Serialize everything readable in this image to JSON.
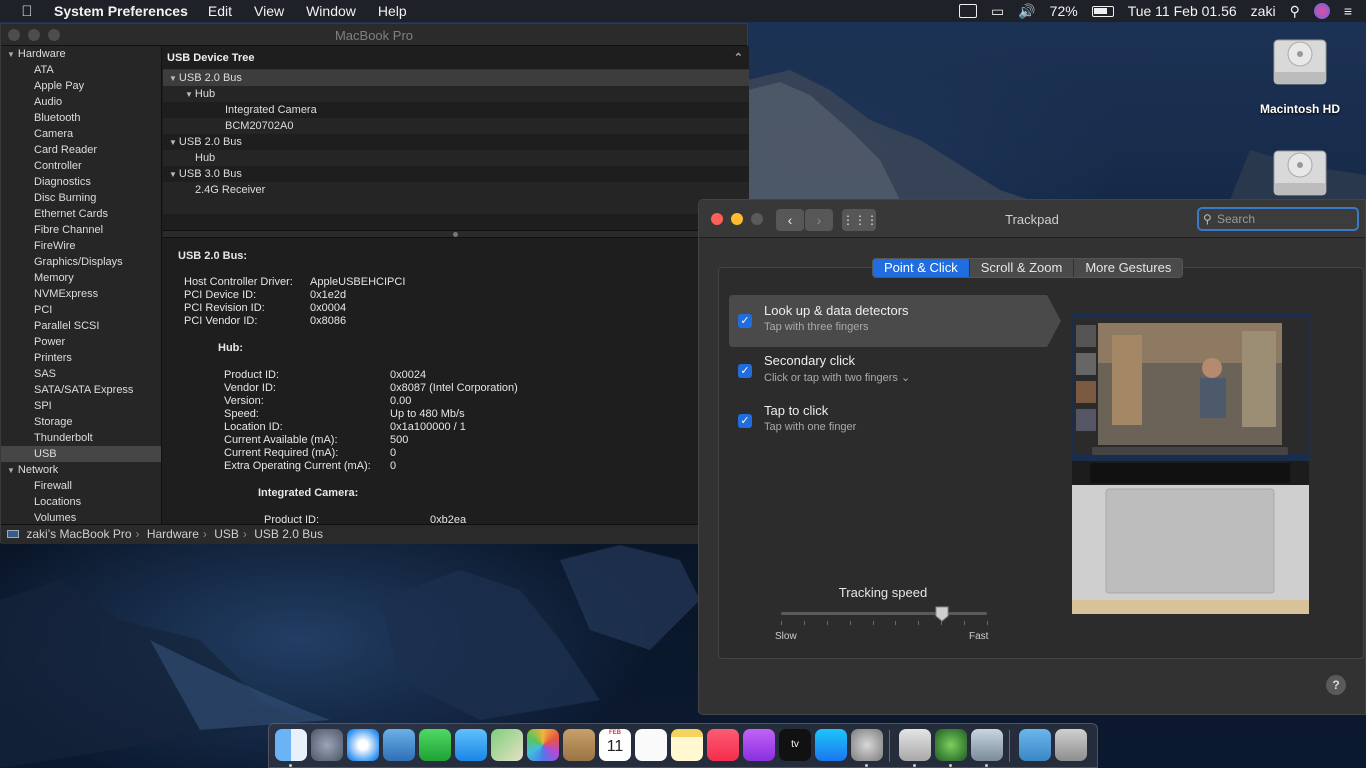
{
  "menubar": {
    "app_name": "System Preferences",
    "menus": [
      "Edit",
      "View",
      "Window",
      "Help"
    ],
    "battery": "72%",
    "clock": "Tue 11 Feb  01.56",
    "user": "zaki"
  },
  "system_info": {
    "title": "MacBook Pro",
    "sidebar": {
      "hardware_label": "Hardware",
      "hardware_items": [
        "ATA",
        "Apple Pay",
        "Audio",
        "Bluetooth",
        "Camera",
        "Card Reader",
        "Controller",
        "Diagnostics",
        "Disc Burning",
        "Ethernet Cards",
        "Fibre Channel",
        "FireWire",
        "Graphics/Displays",
        "Memory",
        "NVMExpress",
        "PCI",
        "Parallel SCSI",
        "Power",
        "Printers",
        "SAS",
        "SATA/SATA Express",
        "SPI",
        "Storage",
        "Thunderbolt",
        "USB"
      ],
      "selected": "USB",
      "network_label": "Network",
      "network_items": [
        "Firewall",
        "Locations",
        "Volumes"
      ]
    },
    "tree": {
      "header": "USB Device Tree",
      "rows": [
        {
          "label": "USB 2.0 Bus",
          "level": 0,
          "expanded": true
        },
        {
          "label": "Hub",
          "level": 1,
          "expanded": true
        },
        {
          "label": "Integrated Camera",
          "level": 2,
          "expanded": false
        },
        {
          "label": "BCM20702A0",
          "level": 2,
          "expanded": false
        },
        {
          "label": "USB 2.0 Bus",
          "level": 0,
          "expanded": true
        },
        {
          "label": "Hub",
          "level": 1,
          "expanded": false
        },
        {
          "label": "USB 3.0 Bus",
          "level": 0,
          "expanded": true
        },
        {
          "label": "2.4G Receiver",
          "level": 1,
          "expanded": false
        }
      ]
    },
    "detail": {
      "bus_title": "USB 2.0 Bus:",
      "bus_props": [
        {
          "k": "Host Controller Driver:",
          "v": "AppleUSBEHCIPCI"
        },
        {
          "k": "PCI Device ID:",
          "v": "0x1e2d"
        },
        {
          "k": "PCI Revision ID:",
          "v": "0x0004"
        },
        {
          "k": "PCI Vendor ID:",
          "v": "0x8086"
        }
      ],
      "hub_title": "Hub:",
      "hub_props": [
        {
          "k": "Product ID:",
          "v": "0x0024"
        },
        {
          "k": "Vendor ID:",
          "v": "0x8087  (Intel Corporation)"
        },
        {
          "k": "Version:",
          "v": "0.00"
        },
        {
          "k": "Speed:",
          "v": "Up to 480 Mb/s"
        },
        {
          "k": "Location ID:",
          "v": "0x1a100000 / 1"
        },
        {
          "k": "Current Available (mA):",
          "v": "500"
        },
        {
          "k": "Current Required (mA):",
          "v": "0"
        },
        {
          "k": "Extra Operating Current (mA):",
          "v": "0"
        }
      ],
      "camera_title": "Integrated Camera:",
      "camera_props": [
        {
          "k": "Product ID:",
          "v": "0xb2ea"
        }
      ]
    },
    "path": [
      "zaki’s MacBook Pro",
      "Hardware",
      "USB",
      "USB 2.0 Bus"
    ]
  },
  "trackpad": {
    "title": "Trackpad",
    "search_placeholder": "Search",
    "tabs": [
      "Point & Click",
      "Scroll & Zoom",
      "More Gestures"
    ],
    "active_tab": "Point & Click",
    "options": [
      {
        "title": "Look up & data detectors",
        "subtitle": "Tap with three fingers",
        "checked": true,
        "selected": true
      },
      {
        "title": "Secondary click",
        "subtitle": "Click or tap with two fingers",
        "checked": true,
        "selected": false
      },
      {
        "title": "Tap to click",
        "subtitle": "Tap with one finger",
        "checked": true,
        "selected": false
      }
    ],
    "tracking_speed_label": "Tracking speed",
    "slow_label": "Slow",
    "fast_label": "Fast",
    "tracking_speed_value": 0.78,
    "help": "?"
  },
  "desktop": {
    "disk_label": "Macintosh HD"
  },
  "dock": {
    "apps": [
      "finder-icon",
      "launchpad-icon",
      "safari-icon",
      "mail-icon",
      "facetime-icon",
      "messages-icon",
      "maps-icon",
      "photos-icon",
      "contacts-icon",
      "calendar-icon",
      "reminders-icon",
      "notes-icon",
      "music-icon",
      "podcasts-icon",
      "tv-icon",
      "app-store-icon",
      "system-preferences-icon",
      "preview-icon",
      "activity-icon",
      "grapher-icon",
      "downloads-folder-icon",
      "trash-icon"
    ],
    "calendar_month": "FEB",
    "calendar_day": "11",
    "tv_label": "tv"
  }
}
